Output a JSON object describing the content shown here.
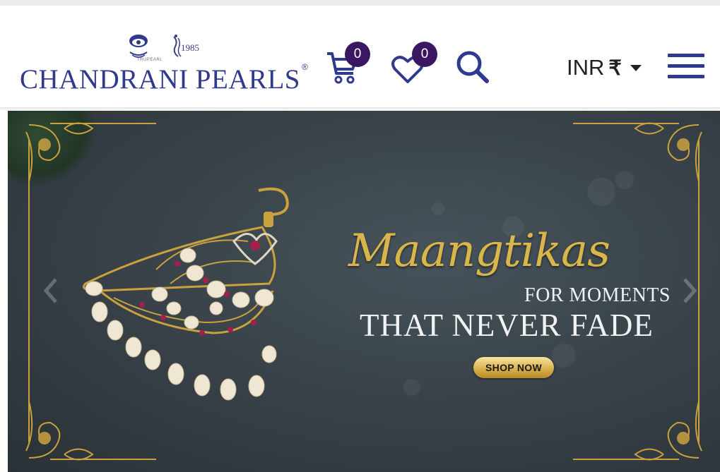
{
  "header": {
    "brand_name": "CHANDRANI PEARLS",
    "brand_reg": "®",
    "brand_year": "1985",
    "brand_mark_text": "TRUPEARL",
    "cart_count": "0",
    "wishlist_count": "0",
    "currency_code": "INR",
    "currency_symbol": "₹"
  },
  "icons": {
    "cart": "cart-icon",
    "wishlist": "heart-icon",
    "search": "search-icon",
    "menu": "hamburger-menu-icon",
    "dropdown": "caret-down-icon",
    "prev": "chevron-left-icon",
    "next": "chevron-right-icon"
  },
  "banner": {
    "script_title": "Maangtikas",
    "subtitle_line1": "FOR MOMENTS",
    "subtitle_line2": "THAT NEVER FADE",
    "cta_label": "SHOP NOW"
  },
  "colors": {
    "brand_blue": "#2f3a8f",
    "badge_purple": "#3b1763",
    "gold": "#d9b64a",
    "banner_bg": "#394349"
  }
}
